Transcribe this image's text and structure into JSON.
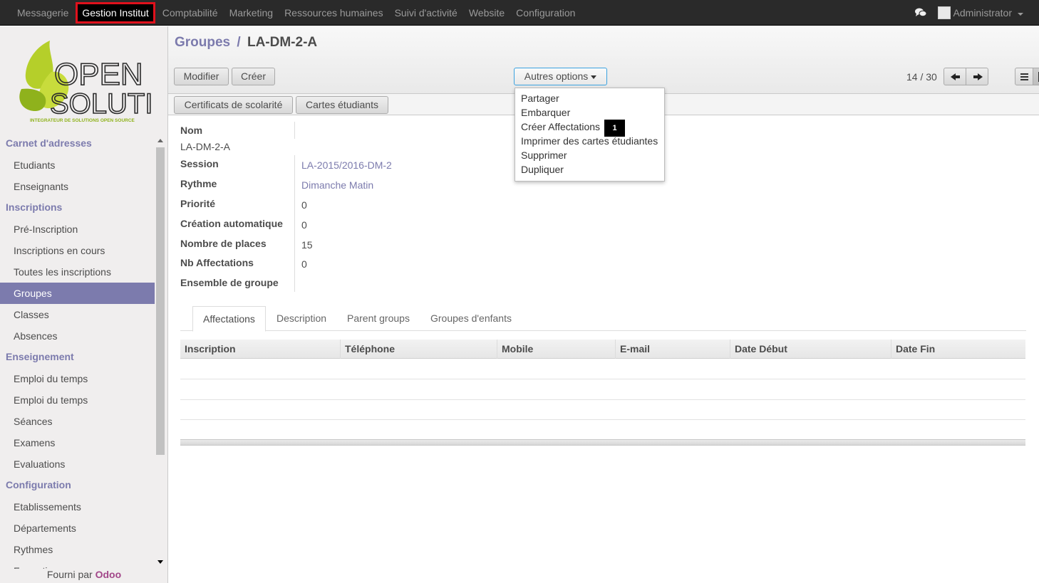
{
  "topbar": {
    "menu": [
      "Messagerie",
      "Gestion Institut",
      "Comptabilité",
      "Marketing",
      "Ressources humaines",
      "Suivi d'activité",
      "Website",
      "Configuration"
    ],
    "active_index": 1,
    "user": "Administrator",
    "chat_icon": "chat-bubbles-icon"
  },
  "logo": {
    "line1": "OPEN",
    "line2": "SOLUTIS",
    "tagline": "INTEGRATEUR DE SOLUTIONS OPEN SOURCE",
    "colors": {
      "leaf_green": "#b5cf2a",
      "leaf_dark": "#8fb21c",
      "text": "#2b2b2b",
      "tagline": "#8fb21c"
    }
  },
  "sidebar": {
    "sections": [
      {
        "title": "Carnet d'adresses",
        "items": [
          "Etudiants",
          "Enseignants"
        ]
      },
      {
        "title": "Inscriptions",
        "items": [
          "Pré-Inscription",
          "Inscriptions en cours",
          "Toutes les inscriptions",
          "Groupes",
          "Classes",
          "Absences"
        ]
      },
      {
        "title": "Enseignement",
        "items": [
          "Emploi du temps",
          "Emploi du temps",
          "Séances",
          "Examens",
          "Evaluations"
        ]
      },
      {
        "title": "Configuration",
        "items": [
          "Etablissements",
          "Départements",
          "Rythmes",
          "Formations"
        ]
      }
    ],
    "active_item": "Groupes",
    "footer_prefix": "Fourni par",
    "footer_brand": "Odoo"
  },
  "header": {
    "breadcrumb_parent": "Groupes",
    "breadcrumb_sep": "/",
    "breadcrumb_current": "LA-DM-2-A",
    "edit_label": "Modifier",
    "create_label": "Créer",
    "more_label": "Autres options",
    "pager": "14 / 30"
  },
  "statusbar": {
    "certificates_label": "Certificats de scolarité",
    "cards_label": "Cartes étudiants"
  },
  "dropdown": {
    "items": [
      "Partager",
      "Embarquer",
      "Créer Affectations",
      "Imprimer des cartes étudiantes",
      "Supprimer",
      "Dupliquer"
    ],
    "badge": "1"
  },
  "form": {
    "nom_label": "Nom",
    "nom_value": "LA-DM-2-A",
    "session_label": "Session",
    "session_value": "LA-2015/2016-DM-2",
    "rythme_label": "Rythme",
    "rythme_value": "Dimanche Matin",
    "priorite_label": "Priorité",
    "priorite_value": "0",
    "creation_label": "Création automatique",
    "creation_value": "0",
    "places_label": "Nombre de places",
    "places_value": "15",
    "affectations_label": "Nb Affectations",
    "affectations_value": "0",
    "ensemble_label": "Ensemble de groupe"
  },
  "tabs": [
    "Affectations",
    "Description",
    "Parent groups",
    "Groupes d'enfants"
  ],
  "table": {
    "columns": [
      "Inscription",
      "Téléphone",
      "Mobile",
      "E-mail",
      "Date Début",
      "Date Fin"
    ]
  }
}
